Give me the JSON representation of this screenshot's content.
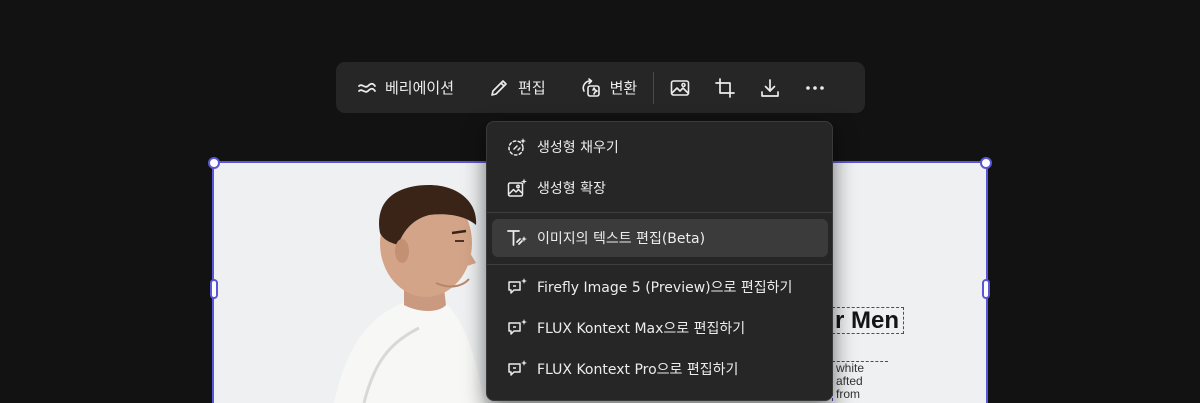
{
  "toolbar": {
    "variation_label": "베리에이션",
    "edit_label": "편집",
    "transform_label": "변환",
    "icons": [
      "wave-icon",
      "pencil-icon",
      "transform-icon",
      "image-icon",
      "crop-icon",
      "download-icon",
      "more-icon"
    ]
  },
  "menu": {
    "items": [
      {
        "label": "생성형 채우기",
        "icon": "generative-fill-icon"
      },
      {
        "label": "생성형 확장",
        "icon": "generative-expand-icon"
      },
      {
        "label": "이미지의 텍스트 편집(Beta)",
        "icon": "text-edit-icon",
        "active": true
      },
      {
        "label": "Firefly Image 5 (Preview)으로 편집하기",
        "icon": "chat-edit-icon"
      },
      {
        "label": "FLUX Kontext Max으로 편집하기",
        "icon": "chat-edit-icon"
      },
      {
        "label": "FLUX Kontext Pro으로 편집하기",
        "icon": "chat-edit-icon"
      }
    ]
  },
  "canvas": {
    "heading_fragment": "r Men",
    "body_fragment_lines": [
      "white",
      "afted from"
    ]
  },
  "colors": {
    "background": "#121212",
    "panel": "#262626",
    "selection": "#5a57d6",
    "active_item": "#3b3b3b"
  }
}
